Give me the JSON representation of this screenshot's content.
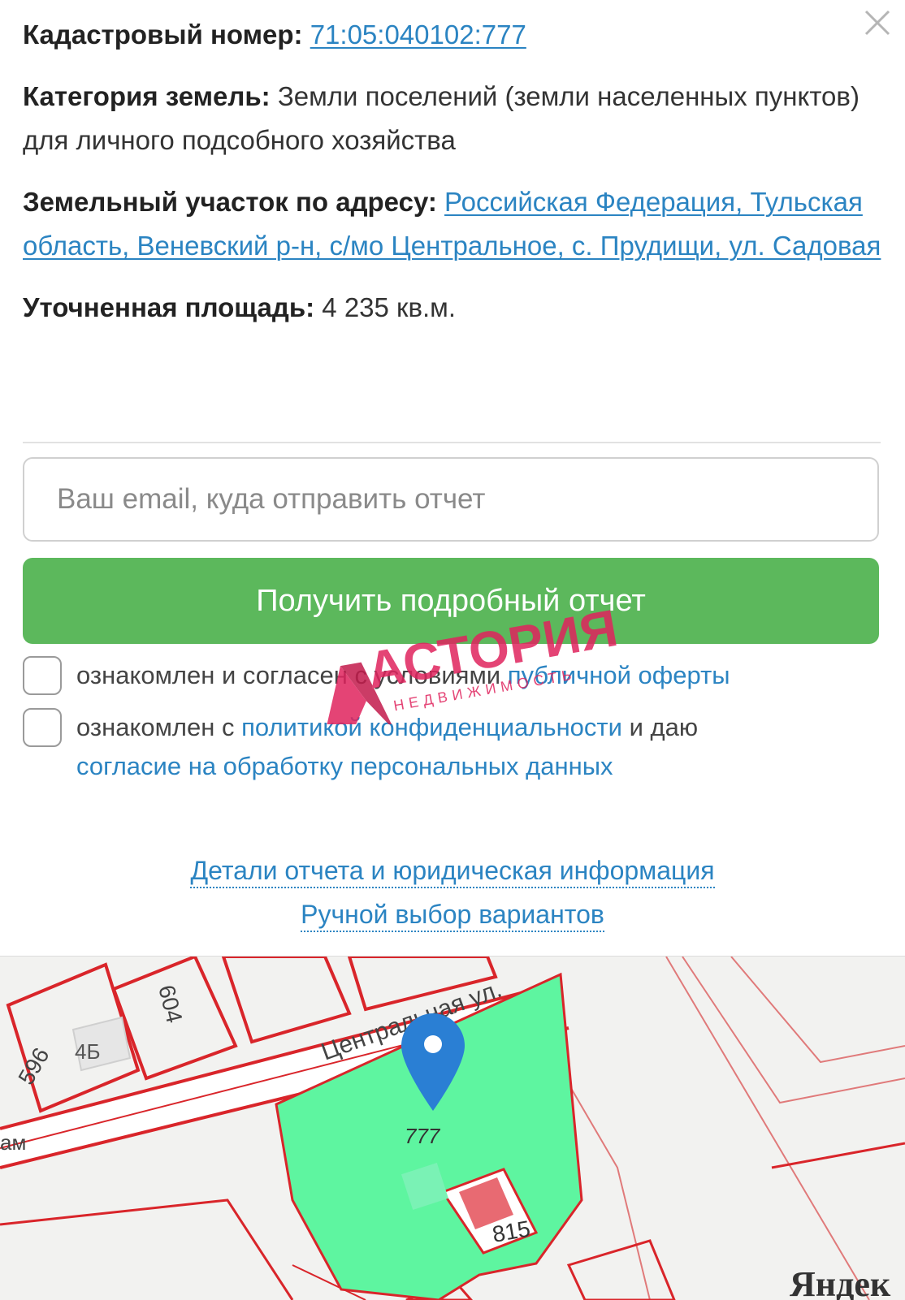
{
  "info": {
    "cadastral_label": "Кадастровый номер:",
    "cadastral_value": "71:05:040102:777",
    "category_label": "Категория земель:",
    "category_value": "Земли поселений (земли населенных пунктов)",
    "category_use": "для личного подсобного хозяйства",
    "address_label": "Земельный участок по адресу:",
    "address_value": "Российская Федерация, Тульская область, Веневский р-н, с/мо Центральное, с. Прудищи, ул. Садовая",
    "area_label": "Уточненная площадь:",
    "area_value": "4 235 кв.м."
  },
  "form": {
    "email_placeholder": "Ваш email, куда отправить отчет",
    "submit_label": "Получить подробный отчет",
    "consent1_text": "ознакомлен и согласен с условиями",
    "consent1_link": "публичной оферты",
    "consent2_text": "ознакомлен с",
    "consent2_link": "политикой конфиденциальности",
    "consent2_mid": "и даю",
    "consent2_link2": "согласие на обработку персональных данных"
  },
  "links": {
    "details": "Детали отчета и юридическая информация",
    "manual": "Ручной выбор вариантов"
  },
  "watermark": {
    "brand": "АСТОРИЯ",
    "sub": "НЕДВИЖИМОСТЬ"
  },
  "map": {
    "street_label": "Центральная ул.",
    "parcel_label": "777",
    "lot_596": "596",
    "lot_4b": "4Б",
    "lot_604": "604",
    "lot_815": "815",
    "edge_label": "ам",
    "provider": "Яндек",
    "colors": {
      "parcel": "#5ef5a0",
      "boundary": "#d9252a",
      "pin": "#2a7fd4"
    }
  }
}
